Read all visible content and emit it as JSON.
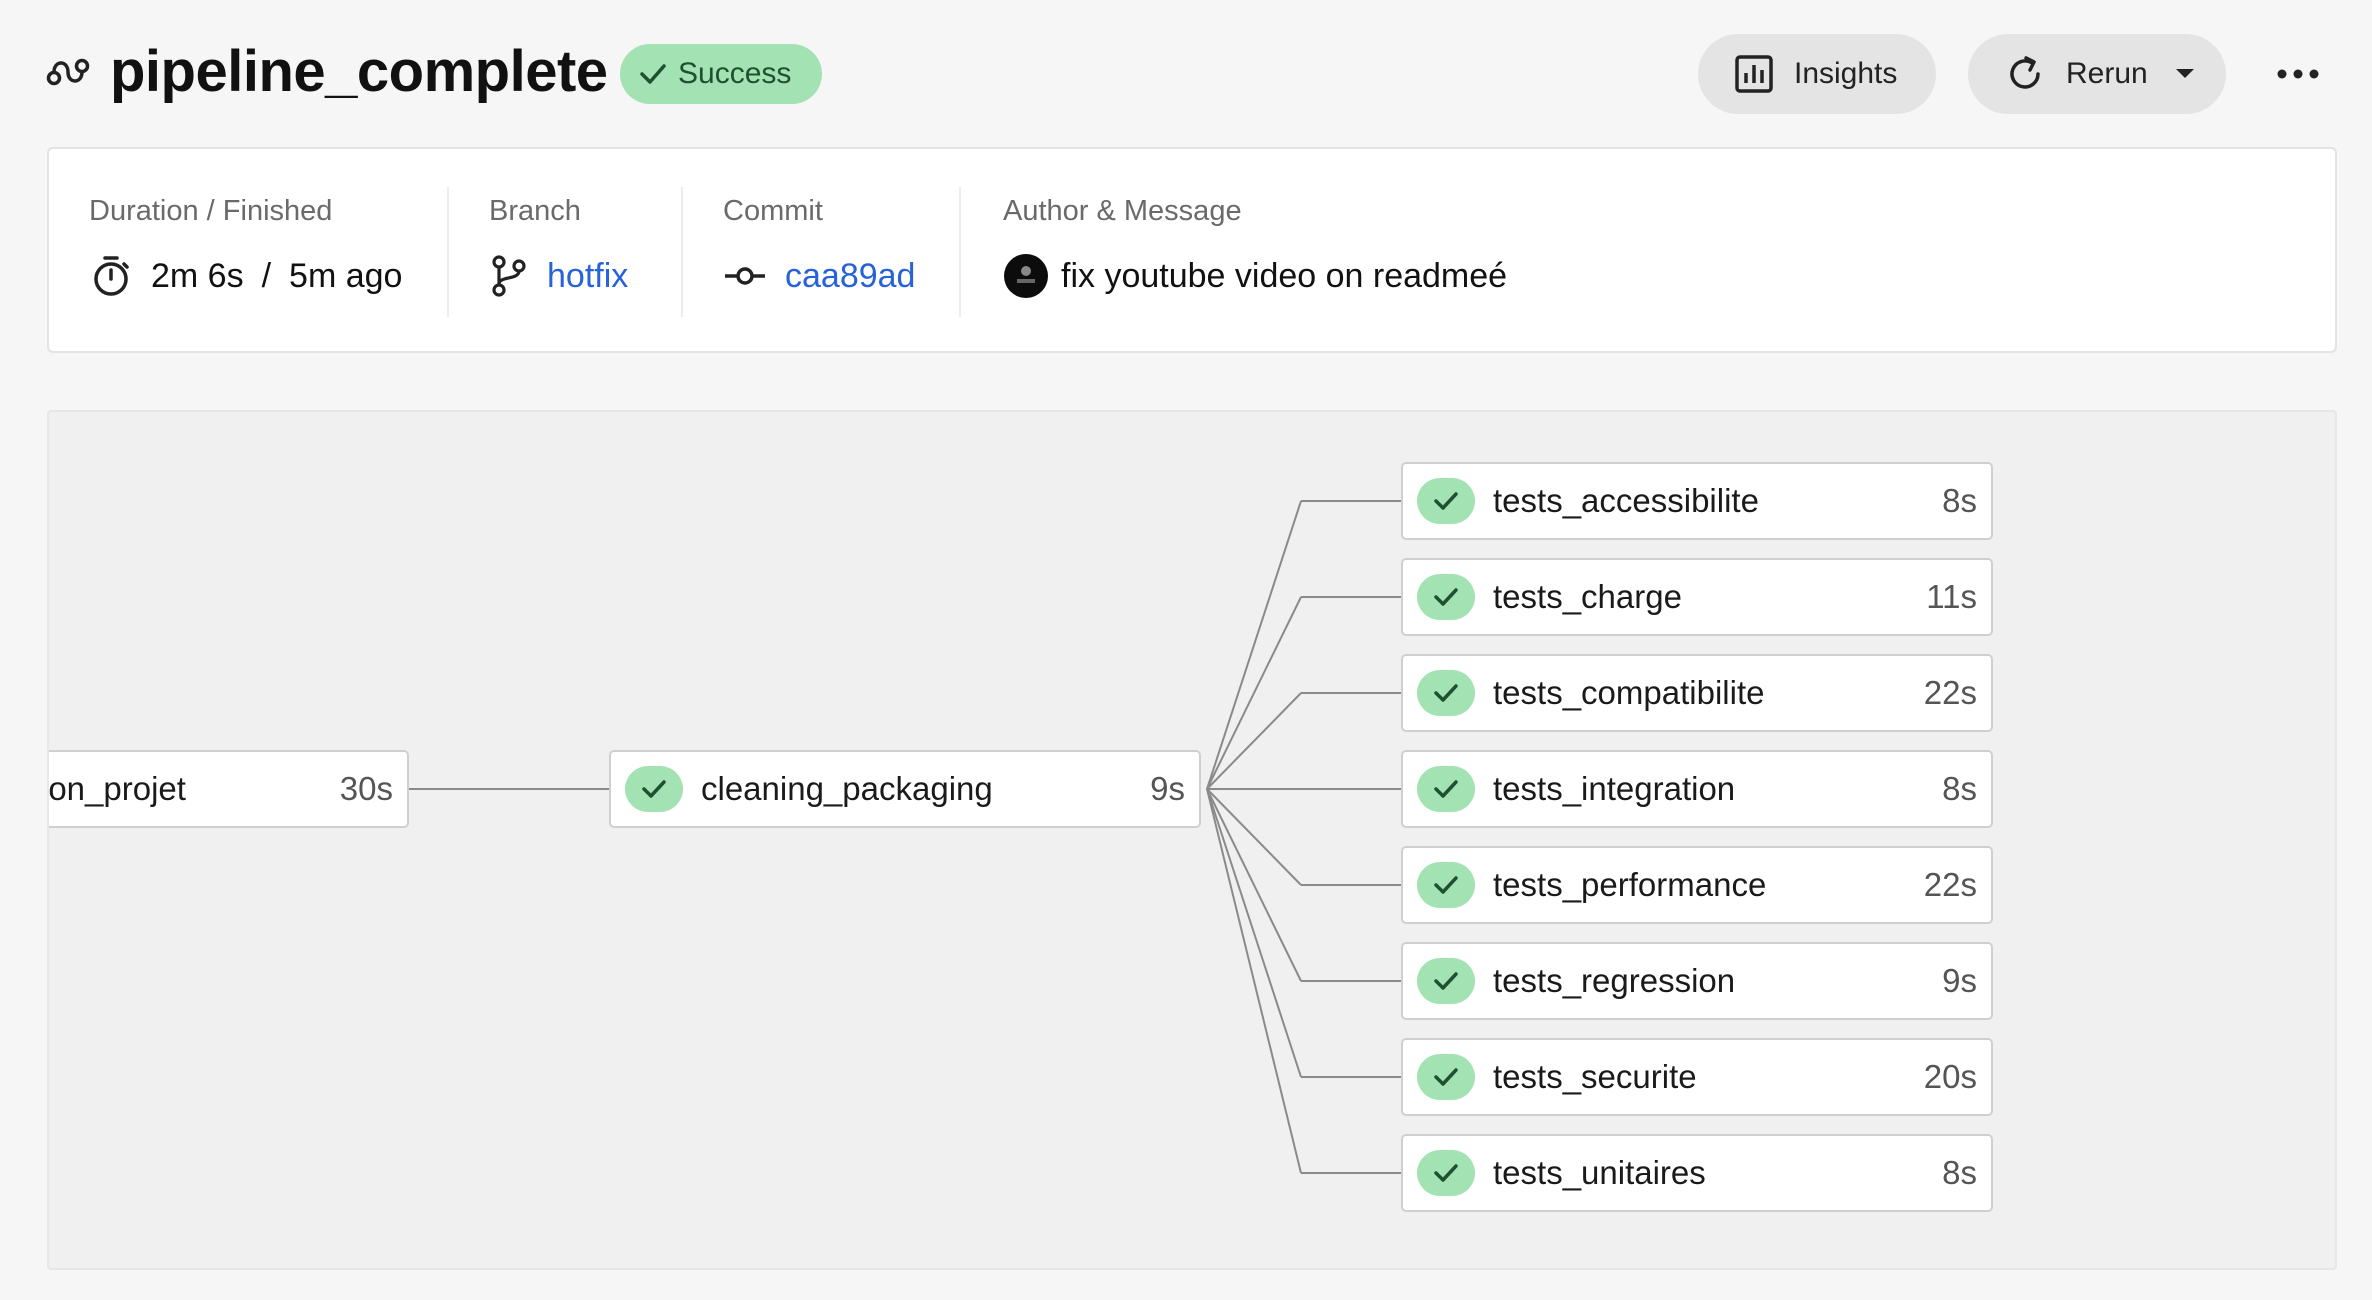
{
  "header": {
    "pipeline_name": "pipeline_complete",
    "status": "Success",
    "insights_label": "Insights",
    "rerun_label": "Rerun",
    "icons": [
      "pipeline-icon",
      "check-icon",
      "chart-icon",
      "refresh-icon",
      "caret-down-icon",
      "more-icon"
    ]
  },
  "info": {
    "duration_caption": "Duration / Finished",
    "duration": "2m 6s",
    "separator": "/",
    "finished": "5m ago",
    "branch_caption": "Branch",
    "branch": "hotfix",
    "commit_caption": "Commit",
    "commit": "caa89ad",
    "author_caption": "Author & Message",
    "message": "fix youtube video on readmeé"
  },
  "graph": {
    "stages": [
      {
        "name": "ion_projet",
        "duration": "30s"
      },
      {
        "name": "cleaning_packaging",
        "duration": "9s",
        "status": "success"
      }
    ],
    "test_jobs": [
      {
        "name": "tests_accessibilite",
        "duration": "8s",
        "status": "success"
      },
      {
        "name": "tests_charge",
        "duration": "11s",
        "status": "success"
      },
      {
        "name": "tests_compatibilite",
        "duration": "22s",
        "status": "success"
      },
      {
        "name": "tests_integration",
        "duration": "8s",
        "status": "success"
      },
      {
        "name": "tests_performance",
        "duration": "22s",
        "status": "success"
      },
      {
        "name": "tests_regression",
        "duration": "9s",
        "status": "success"
      },
      {
        "name": "tests_securite",
        "duration": "20s",
        "status": "success"
      },
      {
        "name": "tests_unitaires",
        "duration": "8s",
        "status": "success"
      }
    ]
  },
  "colors": {
    "success_fill": "#a3e2b3",
    "success_text": "#1f5130",
    "link": "#2762d9",
    "edge": "#8a8a8a"
  }
}
